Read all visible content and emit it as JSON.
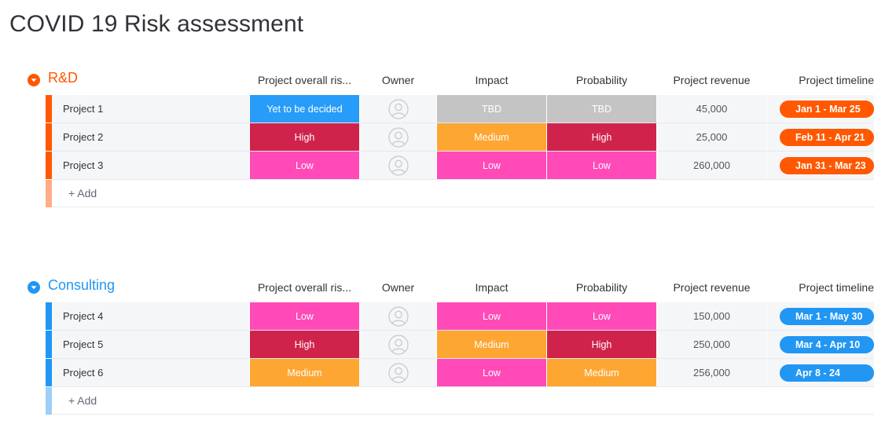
{
  "board": {
    "title": "COVID 19 Risk assessment"
  },
  "columns": {
    "risk": "Project overall ris...",
    "owner": "Owner",
    "impact": "Impact",
    "probability": "Probability",
    "revenue": "Project revenue",
    "timeline": "Project timeline"
  },
  "colors": {
    "rnd_group": "#ff5800",
    "rnd_add_bar": "#ffad85",
    "consulting_group": "#2196f3",
    "consulting_add_bar": "#9ccffa",
    "status_tbd": "#c4c4c4",
    "status_yet_to_be_decided": "#279cf8",
    "status_high": "#d0234c",
    "status_medium": "#fda632",
    "status_low": "#ff4ab8"
  },
  "groups": [
    {
      "name": "R&D",
      "color": "#ff5800",
      "add_label": "+ Add",
      "icon": "chevron-down-circle-icon",
      "rows": [
        {
          "name": "Project 1",
          "risk": "Yet to be decided",
          "risk_color": "#279cf8",
          "owner_icon": "person-placeholder-icon",
          "impact": "TBD",
          "impact_color": "#c4c4c4",
          "probability": "TBD",
          "probability_color": "#c4c4c4",
          "revenue": "45,000",
          "timeline": "Jan 1 - Mar 25"
        },
        {
          "name": "Project 2",
          "risk": "High",
          "risk_color": "#d0234c",
          "owner_icon": "person-placeholder-icon",
          "impact": "Medium",
          "impact_color": "#fda632",
          "probability": "High",
          "probability_color": "#d0234c",
          "revenue": "25,000",
          "timeline": "Feb 11 - Apr 21"
        },
        {
          "name": "Project 3",
          "risk": "Low",
          "risk_color": "#ff4ab8",
          "owner_icon": "person-placeholder-icon",
          "impact": "Low",
          "impact_color": "#ff4ab8",
          "probability": "Low",
          "probability_color": "#ff4ab8",
          "revenue": "260,000",
          "timeline": "Jan 31 - Mar 23"
        }
      ]
    },
    {
      "name": "Consulting",
      "color": "#2196f3",
      "add_label": "+ Add",
      "icon": "chevron-down-circle-icon",
      "rows": [
        {
          "name": "Project 4",
          "risk": "Low",
          "risk_color": "#ff4ab8",
          "owner_icon": "person-placeholder-icon",
          "impact": "Low",
          "impact_color": "#ff4ab8",
          "probability": "Low",
          "probability_color": "#ff4ab8",
          "revenue": "150,000",
          "timeline": "Mar 1 - May 30"
        },
        {
          "name": "Project 5",
          "risk": "High",
          "risk_color": "#d0234c",
          "owner_icon": "person-placeholder-icon",
          "impact": "Medium",
          "impact_color": "#fda632",
          "probability": "High",
          "probability_color": "#d0234c",
          "revenue": "250,000",
          "timeline": "Mar 4 - Apr 10"
        },
        {
          "name": "Project 6",
          "risk": "Medium",
          "risk_color": "#fda632",
          "owner_icon": "person-placeholder-icon",
          "impact": "Low",
          "impact_color": "#ff4ab8",
          "probability": "Medium",
          "probability_color": "#fda632",
          "revenue": "256,000",
          "timeline": "Apr 8 - 24"
        }
      ]
    }
  ]
}
